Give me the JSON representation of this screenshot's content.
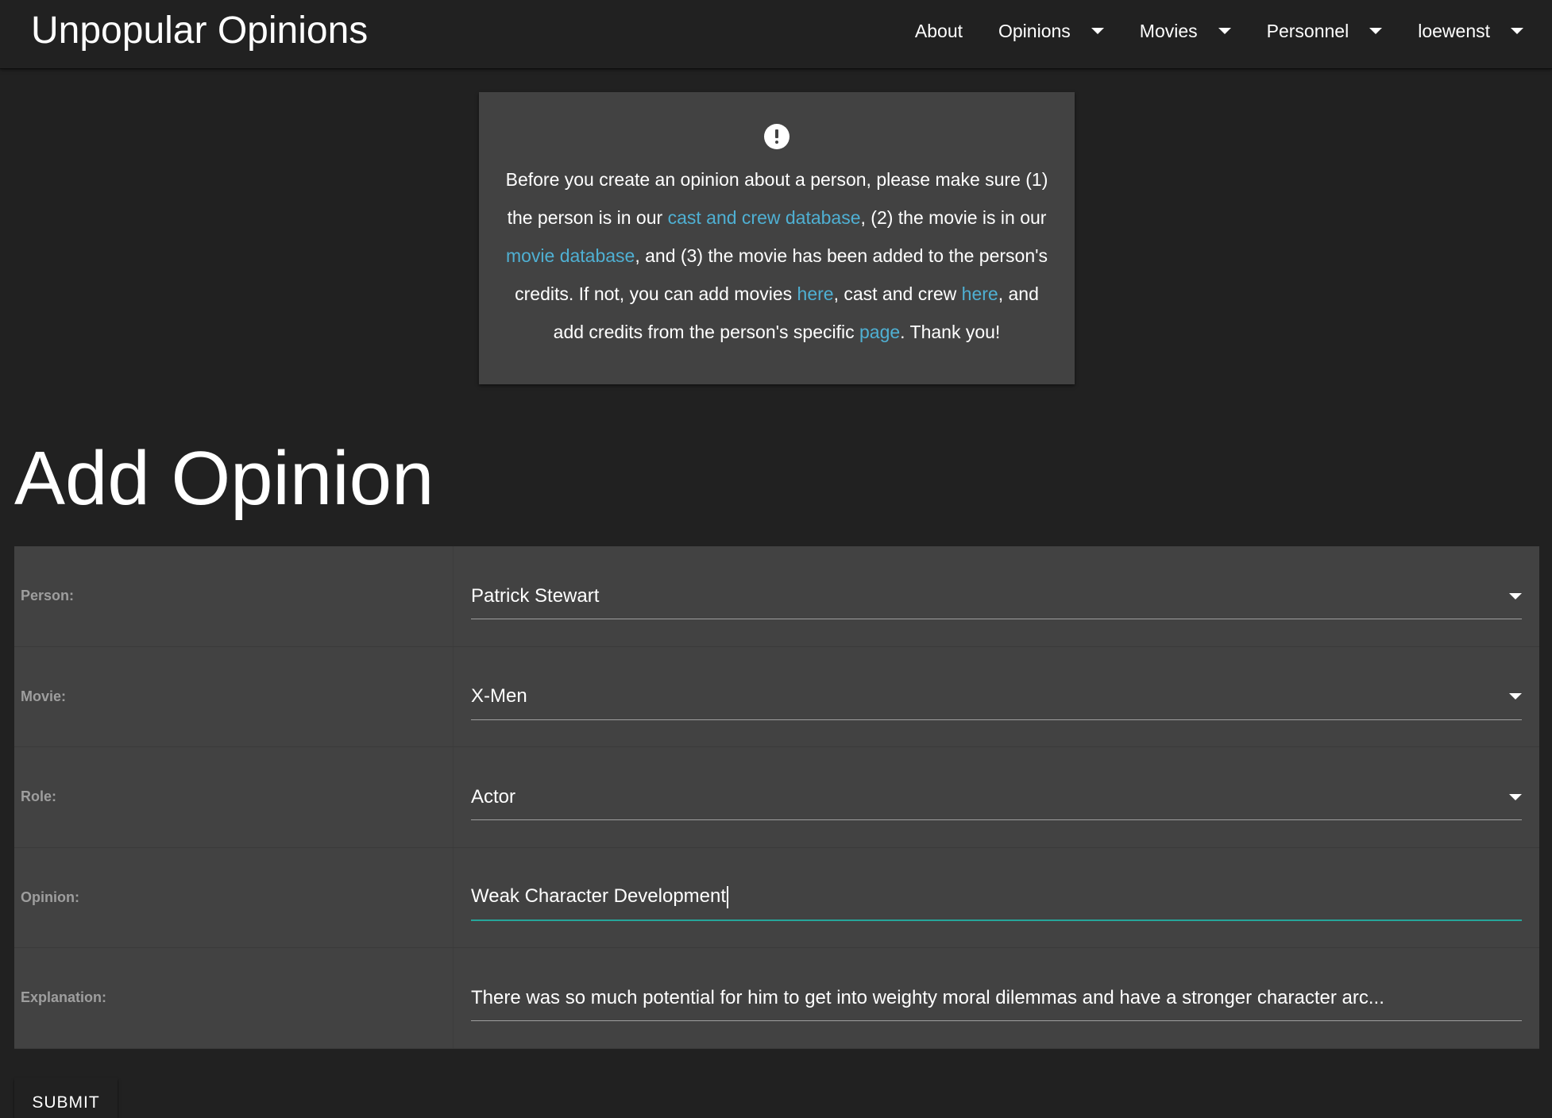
{
  "nav": {
    "brand": "Unpopular Opinions",
    "about": "About",
    "opinions": "Opinions",
    "movies": "Movies",
    "personnel": "Personnel",
    "user": "loewenst"
  },
  "notice": {
    "icon": "exclamation-circle-icon",
    "t1": "Before you create an opinion about a person, please make sure (1) the person is in our ",
    "link_cast_db": "cast and crew database",
    "t2": ", (2) the movie is in our ",
    "link_movie_db": "movie database",
    "t3": ", and (3) the movie has been added to the person's credits. If not, you can add movies ",
    "link_here1": "here",
    "t4": ", cast and crew ",
    "link_here2": "here",
    "t5": ", and add credits from the person's specific ",
    "link_page": "page",
    "t6": ". Thank you!"
  },
  "title": "Add Opinion",
  "form": {
    "person": {
      "label": "Person:",
      "value": "Patrick Stewart"
    },
    "movie": {
      "label": "Movie:",
      "value": "X-Men"
    },
    "role": {
      "label": "Role:",
      "value": "Actor"
    },
    "opinion": {
      "label": "Opinion:",
      "value": "Weak Character Development"
    },
    "explanation": {
      "label": "Explanation:",
      "value": "There was so much potential for him to get into weighty moral dilemmas and have a stronger character arc..."
    }
  },
  "submit_label": "SUBMIT",
  "colors": {
    "link": "#4fb0d3",
    "accent": "#26a69a",
    "card": "#424242",
    "background": "#212121"
  }
}
